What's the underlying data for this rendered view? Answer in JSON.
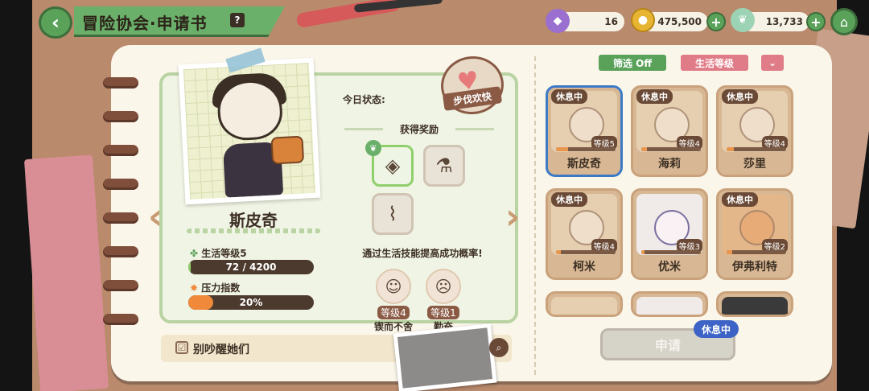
{
  "header": {
    "title": "冒险协会·申请书",
    "help_label": "?"
  },
  "resources": [
    {
      "name": "gem",
      "value": "16",
      "color": "#9a6fd0",
      "icon": "gem-icon"
    },
    {
      "name": "coin",
      "value": "475,500",
      "color": "#e8b532",
      "icon": "coin-icon"
    },
    {
      "name": "leaf",
      "value": "13,733",
      "color": "#7fc6d8",
      "icon": "leaf-icon"
    }
  ],
  "character": {
    "name": "斯皮奇",
    "life_level_label": "生活等级5",
    "exp_text": "72 / 4200",
    "exp_fraction": 0.017,
    "stress_label": "压力指数",
    "stress_text": "20%",
    "stress_fraction": 0.2
  },
  "today": {
    "label": "今日状态:",
    "status": "步伐欢快"
  },
  "rewards": {
    "title": "获得奖励",
    "tip": "通过生活技能提高成功概率!"
  },
  "skills": [
    {
      "level": "等级4",
      "name": "锲而不舍"
    },
    {
      "level": "等级1",
      "name": "勤奋"
    }
  ],
  "dont_wake": {
    "label": "别吵醒她们",
    "checked": "☑"
  },
  "filters": {
    "filter_label": "筛选 Off",
    "sort_label": "生活等级",
    "order_icon": "double-chevron-down-icon"
  },
  "characters": [
    {
      "name": "斯皮奇",
      "status": "休息中",
      "level": "等级5",
      "selected": true
    },
    {
      "name": "海莉",
      "status": "休息中",
      "level": "等级4"
    },
    {
      "name": "莎里",
      "status": "休息中",
      "level": "等级4"
    },
    {
      "name": "柯米",
      "status": "休息中",
      "level": "等级4"
    },
    {
      "name": "优米",
      "status": "休息中",
      "level": "等级3",
      "active": true
    },
    {
      "name": "伊弗利特",
      "status": "休息中",
      "level": "等级2"
    }
  ],
  "apply": {
    "label": "申请",
    "status": "休息中"
  },
  "colors": {
    "green": "#5aa25a",
    "brown": "#6a4a36",
    "blue_select": "#3d7ac6",
    "stress_orange": "#f08a3a"
  }
}
